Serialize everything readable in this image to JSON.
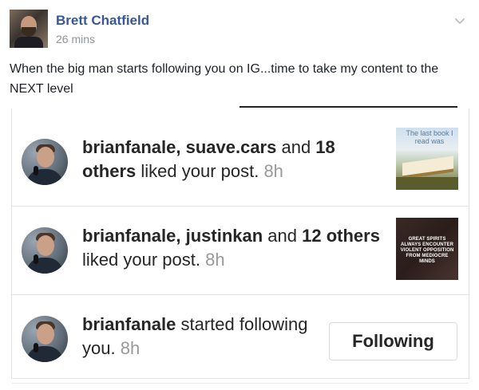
{
  "post": {
    "author_name": "Brett Chatfield",
    "timestamp": "26 mins",
    "text": "When the big man starts following you on IG...time to take my content to the NEXT level"
  },
  "icons": {
    "menu": "chevron-down-icon"
  },
  "notifications": [
    {
      "users": "brianfanale, suave.cars",
      "connector": " and ",
      "others": "18 others",
      "action": " liked your post. ",
      "time": "8h",
      "thumbnail_caption": "The last book I read was"
    },
    {
      "users": "brianfanale, justinkan",
      "connector": " and ",
      "others": "12 others",
      "action": " liked your post. ",
      "time": "8h",
      "thumbnail_caption": "GREAT SPIRITS ALWAYS ENCOUNTER VIOLENT OPPOSITION FROM MEDIOCRE MINDS"
    },
    {
      "users": "brianfanale",
      "action": " started following you. ",
      "time": "8h",
      "button_label": "Following"
    }
  ],
  "colors": {
    "author_link": "#365899",
    "meta_gray": "#90949c",
    "instagram_text": "#262626",
    "instagram_time": "#999999"
  }
}
